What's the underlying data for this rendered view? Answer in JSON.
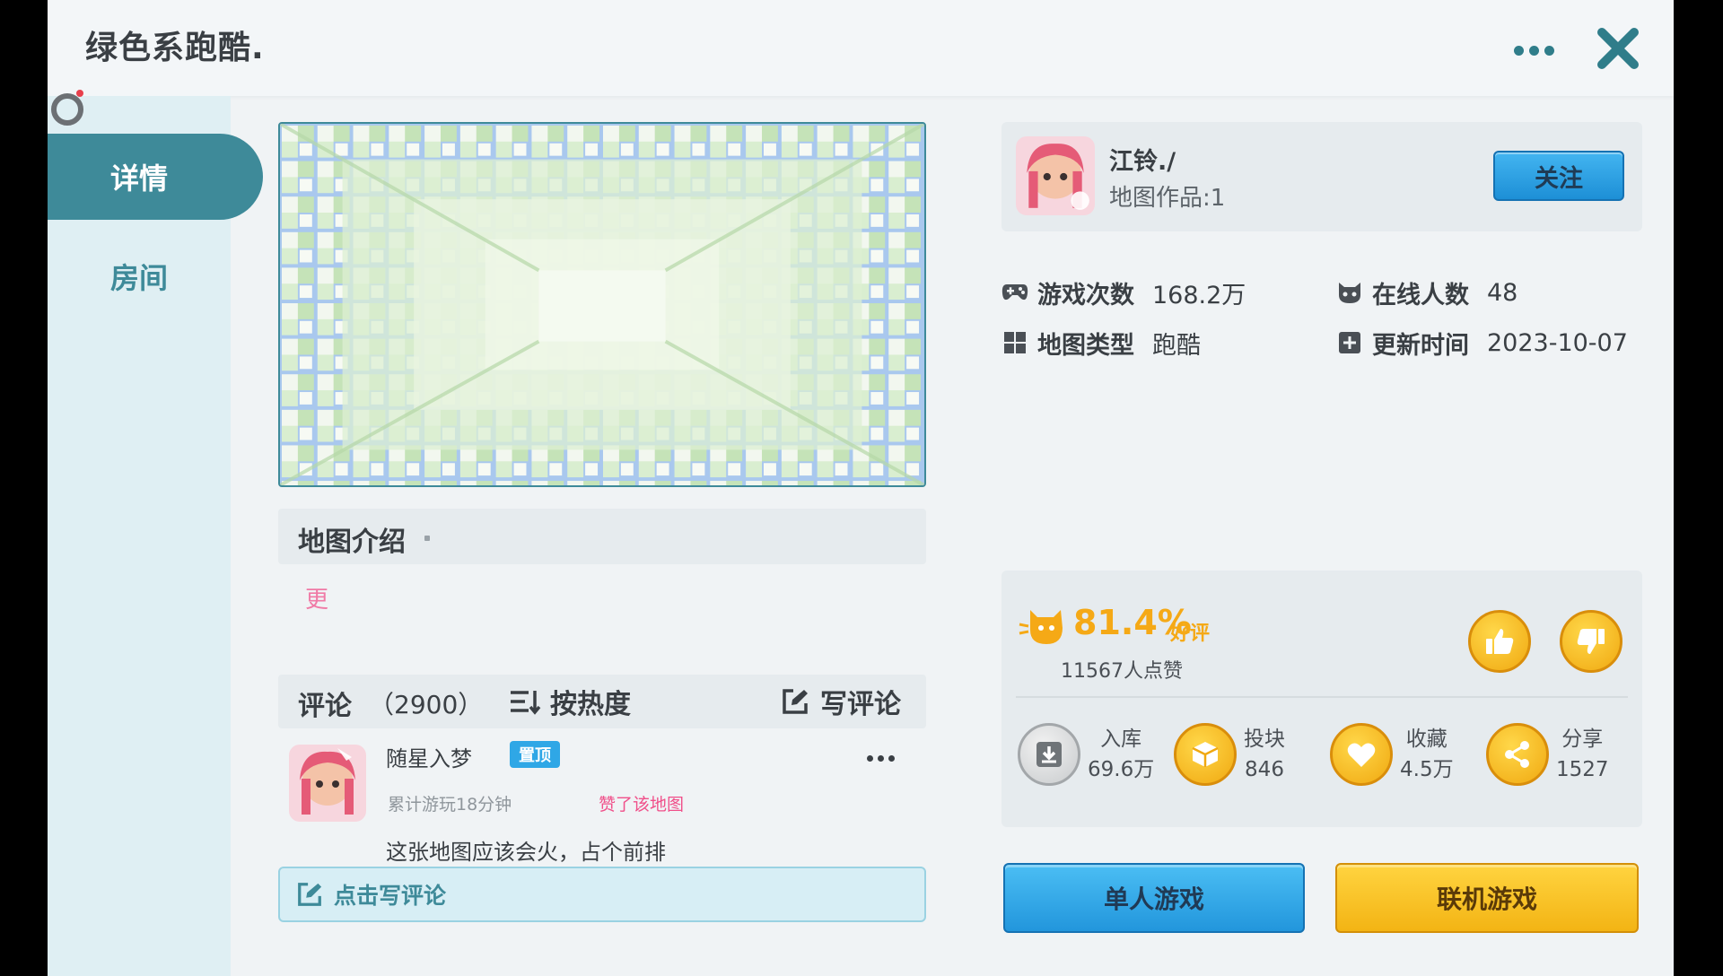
{
  "header": {
    "title": "绿色系跑酷.",
    "more_icon": "more-dots-icon",
    "close_icon": "close-icon"
  },
  "sidebar": {
    "tabs": [
      {
        "label": "详情",
        "active": true
      },
      {
        "label": "房间",
        "active": false
      }
    ]
  },
  "intro": {
    "title": "地图介绍",
    "more_label": "更"
  },
  "comments": {
    "label": "评论",
    "count": "（2900）",
    "sort_label": "按热度",
    "write_label": "写评论",
    "items": [
      {
        "user": "随星入梦",
        "pin_badge": "置顶",
        "playtime": "累计游玩18分钟",
        "liked": "赞了该地图",
        "text": "这张地图应该会火，占个前排"
      }
    ],
    "input_placeholder": "点击写评论"
  },
  "author": {
    "name": "江铃./",
    "works": "地图作品:1",
    "follow_label": "关注"
  },
  "stats": {
    "plays_label": "游戏次数",
    "plays_value": "168.2万",
    "online_label": "在线人数",
    "online_value": "48",
    "type_label": "地图类型",
    "type_value": "跑酷",
    "updated_label": "更新时间",
    "updated_value": "2023-10-07"
  },
  "rating": {
    "percent": "81.4%",
    "good_label": "好评",
    "likes_text": "11567人点赞"
  },
  "actions": [
    {
      "label": "入库",
      "value": "69.6万",
      "icon": "download-icon"
    },
    {
      "label": "投块",
      "value": "846",
      "icon": "block-icon"
    },
    {
      "label": "收藏",
      "value": "4.5万",
      "icon": "heart-icon"
    },
    {
      "label": "分享",
      "value": "1527",
      "icon": "share-icon"
    }
  ],
  "buttons": {
    "single": "单人游戏",
    "multi": "联机游戏"
  },
  "colors": {
    "accent": "#3e8a99",
    "gold": "#f5a916",
    "pink": "#f0508a",
    "blue": "#2296dc"
  }
}
